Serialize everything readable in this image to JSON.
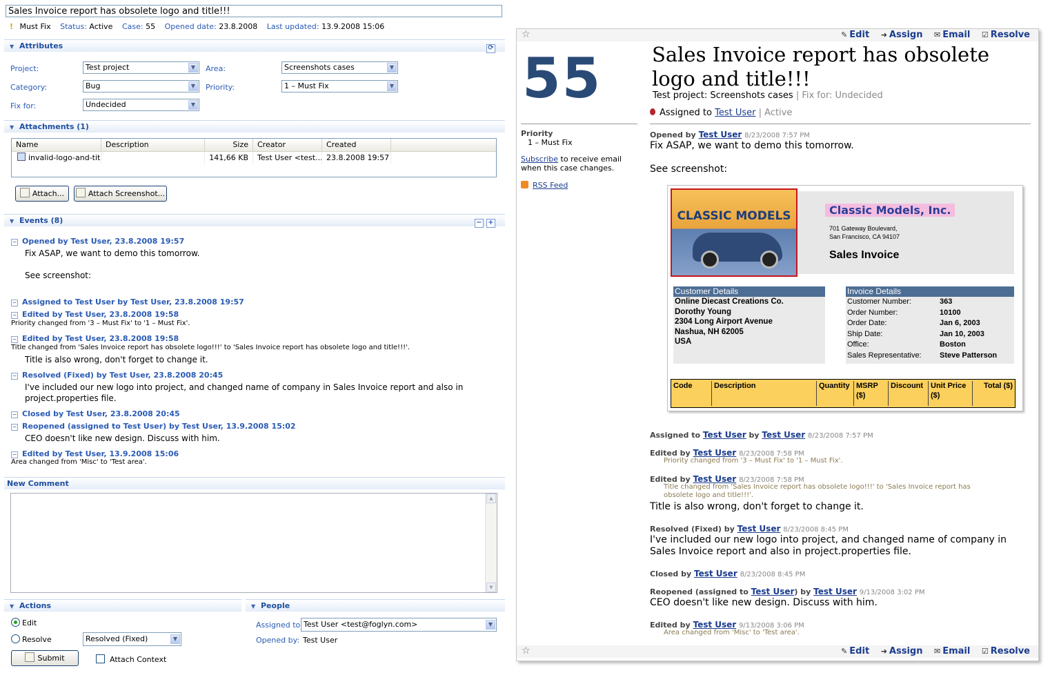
{
  "left": {
    "title_value": "Sales Invoice report has obsolete logo and title!!!",
    "meta": {
      "priority_icon": "!",
      "priority": "Must Fix",
      "status_label": "Status:",
      "status": "Active",
      "case_label": "Case:",
      "case": "55",
      "opened_label": "Opened date:",
      "opened": "23.8.2008",
      "updated_label": "Last updated:",
      "updated": "13.9.2008 15:06"
    },
    "attributes": {
      "header": "Attributes",
      "project_label": "Project:",
      "project": "Test project",
      "area_label": "Area:",
      "area": "Screenshots cases",
      "category_label": "Category:",
      "category": "Bug",
      "priority_label": "Priority:",
      "priority": "1 – Must Fix",
      "fixfor_label": "Fix for:",
      "fixfor": "Undecided"
    },
    "attachments": {
      "header": "Attachments (1)",
      "columns": [
        "Name",
        "Description",
        "Size",
        "Creator",
        "Created"
      ],
      "rows": [
        [
          "invalid-logo-and-tit...",
          "",
          "141,66 KB",
          "Test User <test...",
          "23.8.2008 19:57"
        ]
      ],
      "attach_button": "Attach...",
      "attach_screenshot_button": "Attach Screenshot..."
    },
    "events": {
      "header": "Events (8)",
      "e1_title": "Opened by Test User, 23.8.2008 19:57",
      "e1_body1": "Fix ASAP, we want to demo this tomorrow.",
      "e1_body2": "See screenshot:",
      "e2_title": "Assigned to Test User by Test User, 23.8.2008 19:57",
      "e3_title": "Edited by Test User, 23.8.2008 19:58",
      "e3_small": "Priority changed from '3 – Must Fix' to '1 – Must Fix'.",
      "e4_title": "Edited by Test User, 23.8.2008 19:58",
      "e4_small": "Title changed from 'Sales Invoice report has obsolete logo!!!' to 'Sales Invoice report has obsolete logo and title!!!'.",
      "e4_body": "Title is also wrong, don't forget to change it.",
      "e5_title": "Resolved (Fixed) by Test User, 23.8.2008 20:45",
      "e5_body1": "I've included our new logo into project, and changed name of company in Sales Invoice report and also in",
      "e5_body2": "project.properties file.",
      "e6_title": "Closed by Test User, 23.8.2008 20:45",
      "e7_title": "Reopened (assigned to Test User) by Test User, 13.9.2008 15:02",
      "e7_body": "CEO doesn't like new design. Discuss with him.",
      "e8_title": "Edited by Test User, 13.9.2008 15:06",
      "e8_small": "Area changed from 'Misc' to 'Test area'."
    },
    "new_comment": {
      "header": "New Comment",
      "value": ""
    },
    "actions": {
      "header": "Actions",
      "edit": "Edit",
      "resolve": "Resolve",
      "resolve_select": "Resolved (Fixed)",
      "submit": "Submit",
      "attach_context": "Attach Context"
    },
    "people": {
      "header": "People",
      "assigned_label": "Assigned to:",
      "assigned": "Test User <test@foglyn.com>",
      "opened_label": "Opened by:",
      "opened": "Test User"
    }
  },
  "right": {
    "actions": [
      "Edit",
      "Assign",
      "Email",
      "Resolve"
    ],
    "case_number": "55",
    "title": "Sales Invoice report has obsolete logo and title!!!",
    "project_area": "Test project: Screenshots cases",
    "fix_for": "| Fix for: Undecided",
    "assigned_prefix": "Assigned to",
    "assigned_user": "Test User",
    "status": "| Active",
    "priority_label": "Priority",
    "priority_value": "1 – Must Fix",
    "subscribe_link": "Subscribe",
    "subscribe_text1": "to receive email",
    "subscribe_text2": "when this case changes.",
    "rss": "RSS Feed",
    "events": {
      "e1_head": "Opened by",
      "e1_user": "Test User",
      "e1_date": "8/23/2008 7:57 PM",
      "e1_body1": "Fix ASAP, we want to demo this tomorrow.",
      "e1_body2": "See screenshot:",
      "e2_head": "Assigned to",
      "e2_user": "Test User",
      "e2_by": "by",
      "e2_user2": "Test User",
      "e2_date": "8/23/2008 7:57 PM",
      "e3_head": "Edited by",
      "e3_user": "Test User",
      "e3_date": "8/23/2008 7:58 PM",
      "e3_small": "Priority changed from '3 – Must Fix' to '1 – Must Fix'.",
      "e4_head": "Edited by",
      "e4_user": "Test User",
      "e4_date": "8/23/2008 7:58 PM",
      "e4_small1": "Title changed from 'Sales Invoice report has obsolete logo!!!' to 'Sales Invoice report has",
      "e4_small2": "obsolete logo and title!!!'.",
      "e4_body": "Title is also wrong, don't forget to change it.",
      "e5_head": "Resolved (Fixed) by",
      "e5_user": "Test User",
      "e5_date": "8/23/2008 8:45 PM",
      "e5_body1": "I've included our new logo into project, and changed name of company in",
      "e5_body2": "Sales Invoice report and also in project.properties file.",
      "e6_head": "Closed by",
      "e6_user": "Test User",
      "e6_date": "8/23/2008 8:45 PM",
      "e7_head": "Reopened (assigned to",
      "e7_user": "Test User",
      "e7_mid": ") by",
      "e7_user2": "Test User",
      "e7_date": "9/13/2008 3:02 PM",
      "e7_body": "CEO doesn't like new design. Discuss with him.",
      "e8_head": "Edited by",
      "e8_user": "Test User",
      "e8_date": "9/13/2008 3:06 PM",
      "e8_small": "Area changed from 'Misc' to 'Test area'."
    },
    "invoice": {
      "logo_text": "CLASSIC MODELS",
      "company": "Classic Models, Inc.",
      "addr1": "701 Gateway Boulevard,",
      "addr2": "San Francisco, CA 94107",
      "doc_title": "Sales Invoice",
      "cust_header": "Customer Details",
      "cust_lines": [
        "Online Diecast Creations Co.",
        "Dorothy Young",
        "2304 Long Airport Avenue",
        "Nashua, NH 62005",
        "USA"
      ],
      "inv_header": "Invoice Details",
      "inv": [
        [
          "Customer Number:",
          "363"
        ],
        [
          "Order Number:",
          "10100"
        ],
        [
          "Order Date:",
          "Jan 6, 2003"
        ],
        [
          "Ship Date:",
          "Jan 10, 2003"
        ],
        [
          "Office:",
          "Boston"
        ],
        [
          "Sales Representative:",
          "Steve Patterson"
        ]
      ],
      "cols": [
        "Code",
        "Description",
        "Quantity",
        "MSRP ($)",
        "Discount",
        "Unit Price ($)",
        "Total ($)"
      ]
    }
  }
}
